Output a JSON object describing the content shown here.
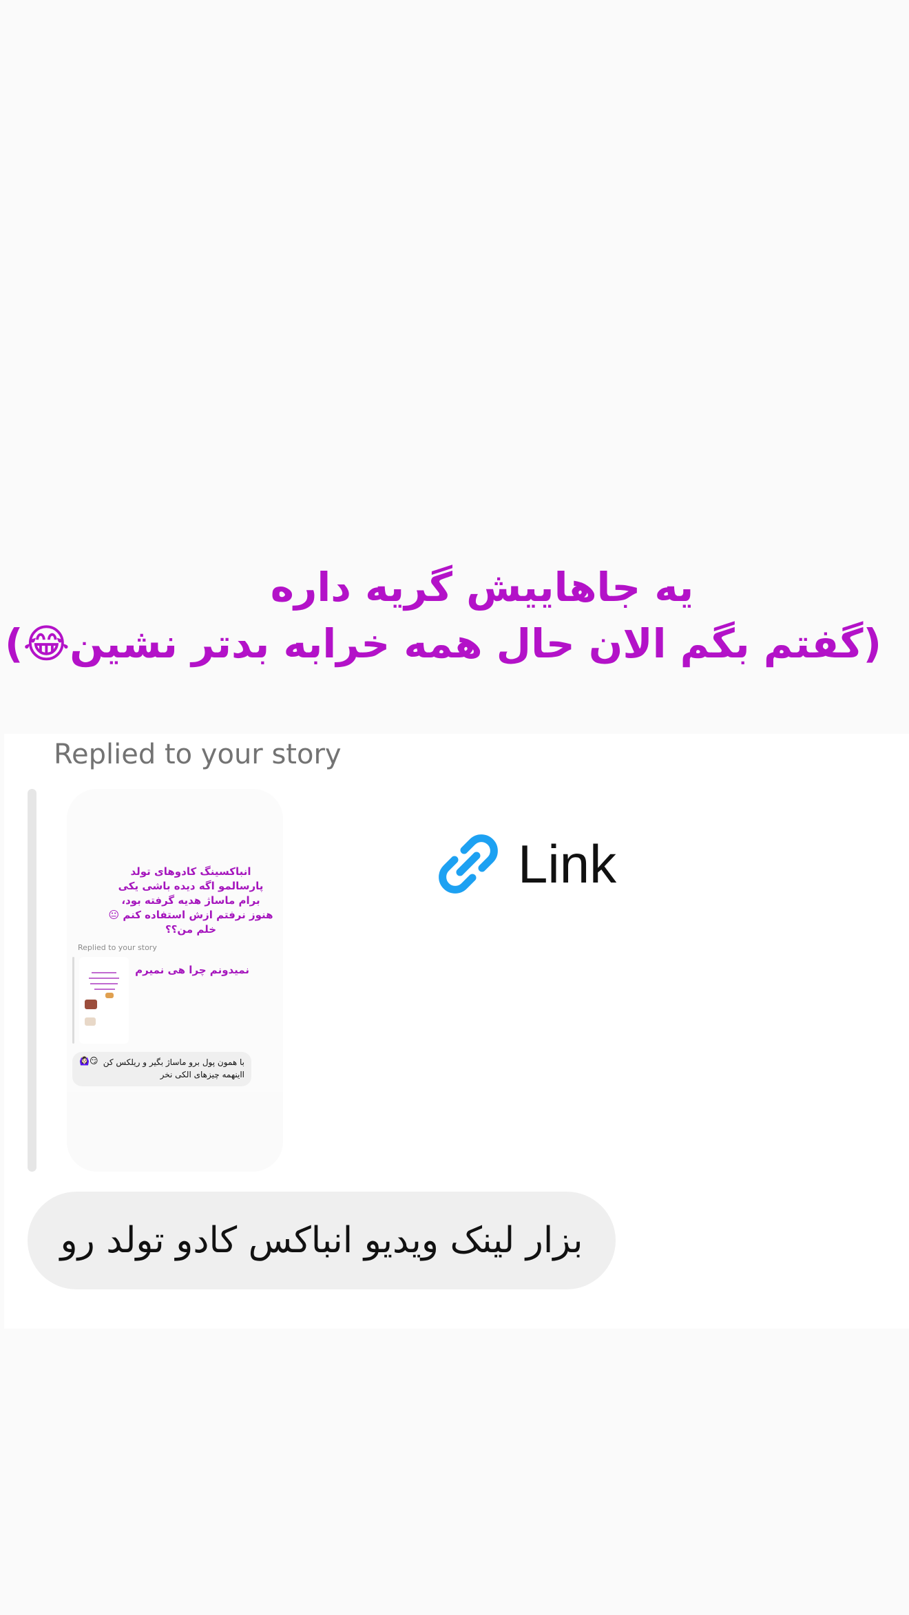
{
  "story_caption": {
    "line1": "یه جاهاییش گریه داره",
    "line2": "(گفتم بگم الان حال همه خرابه بدتر نشین😂)"
  },
  "reply": {
    "replied_label": "Replied to your story",
    "story_thumbnail": {
      "text": "انباکسینگ کادوهای تولد پارسالمو اگه دیده باشی یکی برام ماساژ هدیه گرفته بود، هنوز نرفتم ازش استفاده کنم 😐 خلم من؟؟",
      "replied_label": "Replied to your story",
      "quoted_text": "نمیدونم چرا هی نمیرم",
      "reply_bubble_text": "با همون پول برو ماساژ بگیر و ریلکس کن ااینهمه چیزهای الکی نخر",
      "reply_bubble_emoji": "🙆🏻‍♀️😏"
    },
    "link": {
      "label": "Link",
      "icon": "link-icon",
      "color": "#1da1f2"
    },
    "message": "بزار لینک ویدیو انباکس کادو تولد رو"
  }
}
